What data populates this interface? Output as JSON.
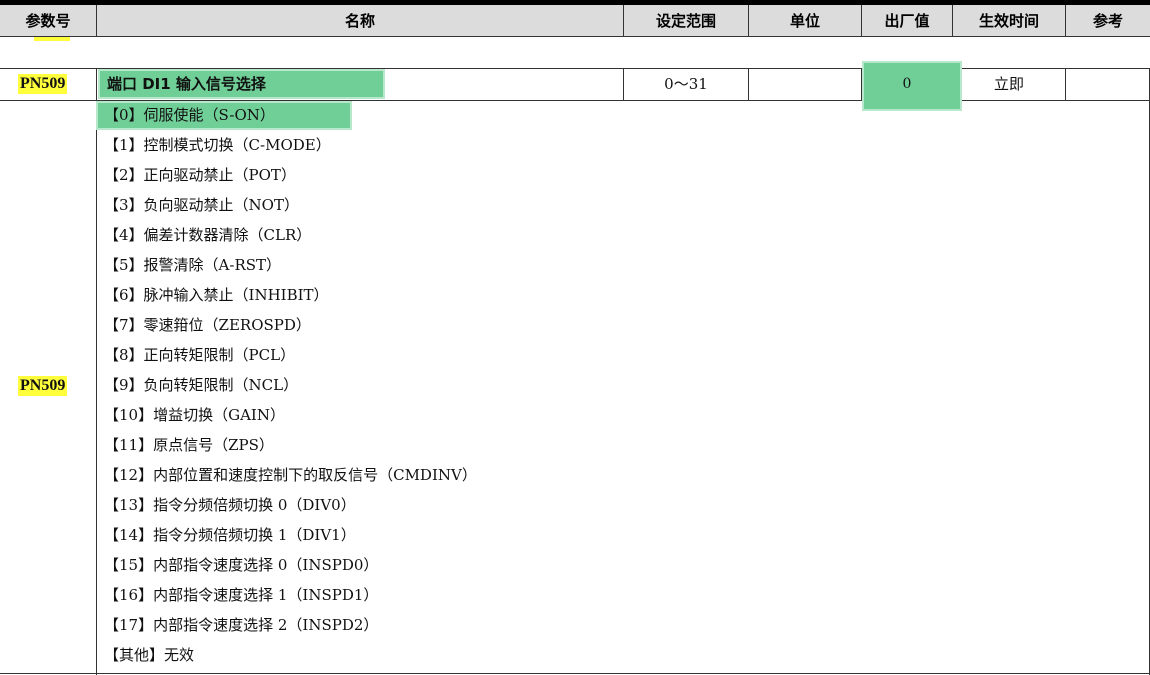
{
  "header": {
    "param_no": "参数号",
    "name": "名称",
    "range": "设定范围",
    "unit": "单位",
    "default": "出厂值",
    "effect_time": "生效时间",
    "reference": "参考"
  },
  "param_row": {
    "param_no": "PN509",
    "name": "端口 DI1 输入信号选择",
    "range": "0～31",
    "unit": "",
    "default": "0",
    "effect_time": "立即",
    "reference": ""
  },
  "options_param_no": "PN509",
  "options": [
    "【0】伺服使能（S-ON）",
    "【1】控制模式切换（C-MODE）",
    "【2】正向驱动禁止（POT）",
    "【3】负向驱动禁止（NOT）",
    "【4】偏差计数器清除（CLR）",
    "【5】报警清除（A-RST）",
    "【6】脉冲输入禁止（INHIBIT）",
    "【7】零速箝位（ZEROSPD）",
    "【8】正向转矩限制（PCL）",
    "【9】负向转矩限制（NCL）",
    "【10】增益切换（GAIN）",
    "【11】原点信号（ZPS）",
    "【12】内部位置和速度控制下的取反信号（CMDINV）",
    "【13】指令分频倍频切换 0（DIV0）",
    "【14】指令分频倍频切换 1（DIV1）",
    "【15】内部指令速度选择 0（INSPD0）",
    "【16】内部指令速度选择 1（INSPD1）",
    "【17】内部指令速度选择 2（INSPD2）",
    "【其他】无效"
  ]
}
